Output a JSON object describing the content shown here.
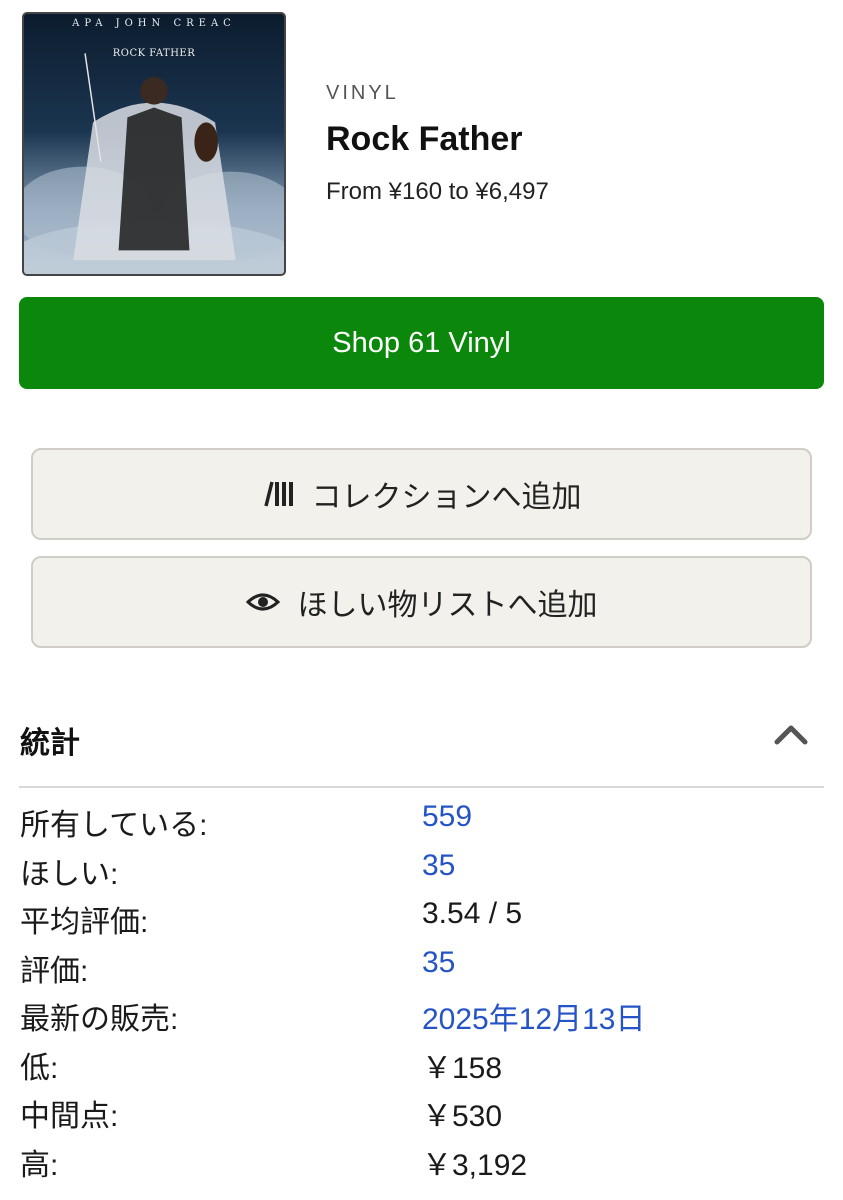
{
  "product": {
    "cover": {
      "artist_text": "APA JOHN CREAC",
      "album_text": "ROCK FATHER"
    },
    "format": "VINYL",
    "title": "Rock Father",
    "price_range": "From ¥160 to ¥6,497"
  },
  "actions": {
    "shop_label": "Shop 61 Vinyl",
    "collection_label": "コレクションへ追加",
    "wantlist_label": "ほしい物リストへ追加"
  },
  "stats": {
    "title": "統計",
    "rows": [
      {
        "label": "所有している:",
        "value": "559"
      },
      {
        "label": "ほしい:",
        "value": "35"
      },
      {
        "label": "平均評価:",
        "value": "3.54 / 5"
      },
      {
        "label": "評価:",
        "value": "35"
      },
      {
        "label": "最新の販売:",
        "value": "2025年12月13日"
      },
      {
        "label": "低:",
        "value": "￥158"
      },
      {
        "label": "中間点:",
        "value": "￥530"
      },
      {
        "label": "高:",
        "value": "￥3,192"
      }
    ]
  },
  "colors": {
    "shop_green": "#0b870b",
    "link_blue": "#2554c7",
    "button_bg": "#f2f1ec"
  },
  "icons": [
    "collection-icon",
    "eye-icon",
    "chevron-up-icon"
  ]
}
